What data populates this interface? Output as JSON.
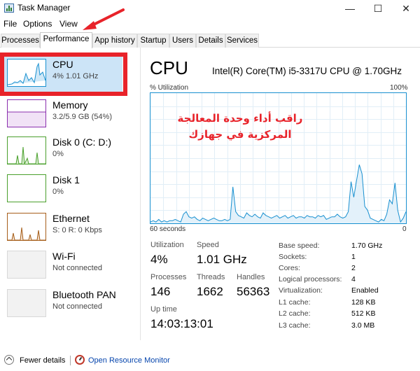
{
  "window": {
    "title": "Task Manager",
    "minimize": "—",
    "maximize": "☐",
    "close": "✕"
  },
  "menu": [
    "File",
    "Options",
    "View"
  ],
  "tabs": [
    "Processes",
    "Performance",
    "App history",
    "Startup",
    "Users",
    "Details",
    "Services"
  ],
  "active_tab": "Performance",
  "resources": [
    {
      "name": "CPU",
      "detail": "4% 1.01 GHz",
      "color": "#1890d0"
    },
    {
      "name": "Memory",
      "detail": "3.2/5.9 GB (54%)",
      "color": "#8b2fae"
    },
    {
      "name": "Disk 0 (C: D:)",
      "detail": "0%",
      "color": "#4aa02c"
    },
    {
      "name": "Disk 1",
      "detail": "0%",
      "color": "#4aa02c"
    },
    {
      "name": "Ethernet",
      "detail": "S: 0 R: 0 Kbps",
      "color": "#a65e1a"
    },
    {
      "name": "Wi-Fi",
      "detail": "Not connected",
      "color": "#c8c8c8"
    },
    {
      "name": "Bluetooth PAN",
      "detail": "Not connected",
      "color": "#c8c8c8"
    }
  ],
  "cpu": {
    "title": "CPU",
    "model": "Intel(R) Core(TM) i5-3317U CPU @ 1.70GHz",
    "util_label": "% Utilization",
    "util_max": "100%",
    "x_left": "60 seconds",
    "x_right": "0",
    "overlay_text": "راقب أداء وحدة المعالجة المركزية في جهازك",
    "overlay_color": "#e8232a",
    "utilization_series": [
      1,
      2,
      1,
      3,
      1,
      2,
      1,
      2,
      2,
      3,
      2,
      1,
      7,
      9,
      5,
      4,
      5,
      3,
      2,
      4,
      3,
      2,
      3,
      4,
      3,
      2,
      2,
      3,
      2,
      3,
      28,
      9,
      6,
      5,
      4,
      8,
      6,
      5,
      7,
      5,
      4,
      8,
      6,
      5,
      4,
      5,
      6,
      4,
      5,
      6,
      4,
      5,
      6,
      4,
      5,
      5,
      4,
      6,
      5,
      5,
      4,
      6,
      5,
      6,
      3,
      4,
      5,
      5,
      7,
      5,
      4,
      5,
      9,
      32,
      20,
      33,
      45,
      38,
      13,
      10,
      4,
      3,
      2,
      1,
      3,
      2,
      7,
      18,
      15,
      31,
      10,
      1,
      4,
      9
    ]
  },
  "stats": {
    "utilization": {
      "label": "Utilization",
      "value": "4%"
    },
    "speed": {
      "label": "Speed",
      "value": "1.01 GHz"
    },
    "processes": {
      "label": "Processes",
      "value": "146"
    },
    "threads": {
      "label": "Threads",
      "value": "1662"
    },
    "handles": {
      "label": "Handles",
      "value": "56363"
    },
    "uptime": {
      "label": "Up time",
      "value": "14:03:13:01"
    }
  },
  "specs": [
    {
      "label": "Base speed:",
      "value": "1.70 GHz"
    },
    {
      "label": "Sockets:",
      "value": "1"
    },
    {
      "label": "Cores:",
      "value": "2"
    },
    {
      "label": "Logical processors:",
      "value": "4"
    },
    {
      "label": "Virtualization:",
      "value": "Enabled"
    },
    {
      "label": "L1 cache:",
      "value": "128 KB"
    },
    {
      "label": "L2 cache:",
      "value": "512 KB"
    },
    {
      "label": "L3 cache:",
      "value": "3.0 MB"
    }
  ],
  "bottom": {
    "fewer_details": "Fewer details",
    "resource_monitor": "Open Resource Monitor"
  },
  "annotation_color": "#e8232a"
}
